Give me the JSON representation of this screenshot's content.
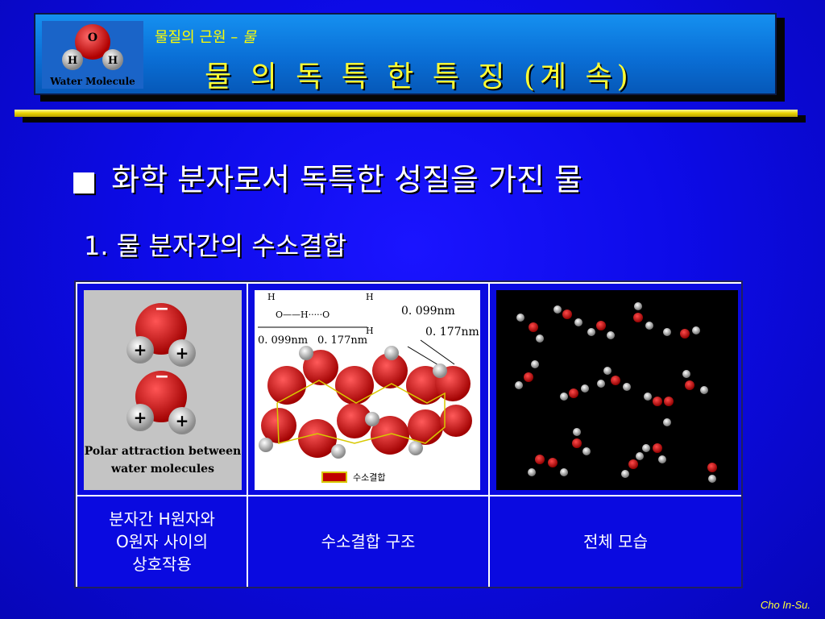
{
  "header": {
    "logo": {
      "atom_o": "O",
      "atom_h1": "H",
      "atom_h2": "H",
      "caption": "Water Molecule"
    },
    "subtitle_prefix": "물질의 근원 – ",
    "subtitle_emph": "물",
    "title": "물 의  독 특 한  특 징 (계 속)"
  },
  "main": {
    "bullet": "■",
    "heading": "화학 분자로서 독특한 성질을 가진 물",
    "subheading": "1. 물 분자간의 수소결합"
  },
  "table": {
    "figures": {
      "polar": {
        "caption_line1": "Polar attraction between",
        "caption_line2": "water molecules",
        "minus": "−",
        "plus": "+"
      },
      "hbond": {
        "h": "H",
        "o": "O",
        "bond_text": "O——H·····O",
        "label_a": "0. 099nm",
        "label_b": "0. 177nm",
        "legend": "수소결합"
      }
    },
    "captions": [
      {
        "lines": [
          "분자간 H원자와",
          "O원자 사이의",
          "상호작용"
        ]
      },
      {
        "lines": [
          "수소결합 구조"
        ]
      },
      {
        "lines": [
          "전체 모습"
        ]
      }
    ]
  },
  "footer": {
    "author": "Cho In-Su."
  },
  "colors": {
    "background": "#0d0be8",
    "title_yellow": "#ffff33",
    "rule_yellow": "#e8d200",
    "header_blue": "#0a6fd6"
  }
}
